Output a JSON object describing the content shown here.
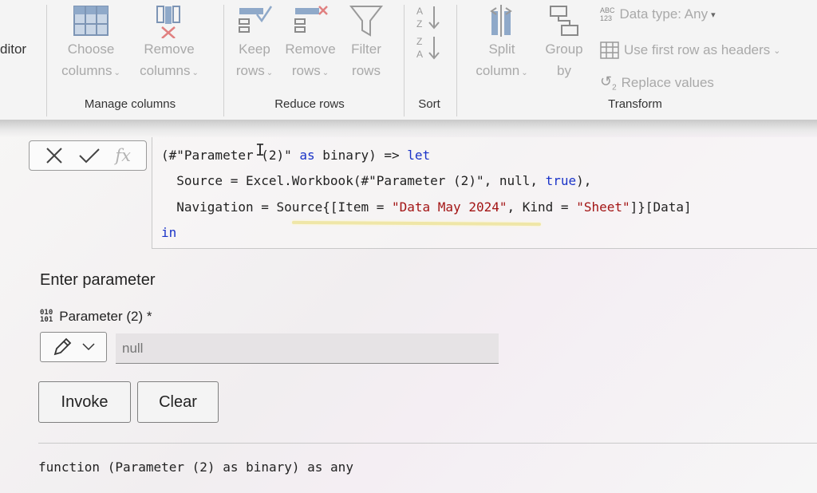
{
  "ribbon": {
    "left_title": "ditor",
    "manage_columns": {
      "label": "Manage columns",
      "choose": {
        "line1": "Choose",
        "line2": "columns"
      },
      "remove": {
        "line1": "Remove",
        "line2": "columns"
      }
    },
    "reduce_rows": {
      "label": "Reduce rows",
      "keep": {
        "line1": "Keep",
        "line2": "rows"
      },
      "remove": {
        "line1": "Remove",
        "line2": "rows"
      },
      "filter": {
        "line1": "Filter",
        "line2": "rows"
      }
    },
    "sort": {
      "label": "Sort"
    },
    "transform": {
      "label": "Transform",
      "split": {
        "line1": "Split",
        "line2": "column"
      },
      "group": {
        "line1": "Group",
        "line2": "by"
      },
      "data_type": "Data type: Any",
      "first_row_headers": "Use first row as headers",
      "replace_values": "Replace values"
    }
  },
  "formula_bar": {
    "cancel_icon": "close-icon",
    "commit_icon": "check-icon",
    "fx_label": "fx"
  },
  "code": {
    "line1": {
      "a": "(#\"Paramete",
      "b": "r (2)\" ",
      "kw1": "as",
      "c": " binary) => ",
      "kw2": "let"
    },
    "line2": {
      "a": "  Source = Excel.Workbook(#\"Parameter (2)\", null, ",
      "kw": "true",
      "b": "),"
    },
    "line3": {
      "a": "  Navigation = Source{[Item = ",
      "s1": "\"Data May 2024\"",
      "b": ", Kind = ",
      "s2": "\"Sheet\"",
      "c": "]}[Data]"
    },
    "line4": {
      "kw": "in"
    }
  },
  "invoke_panel": {
    "title": "Enter parameter",
    "param_label": "Parameter (2) *",
    "param_icon_top": "010",
    "param_icon_bottom": "101",
    "param_placeholder": "null",
    "invoke_label": "Invoke",
    "clear_label": "Clear",
    "signature": "function (Parameter (2) as binary) as any"
  },
  "colors": {
    "keyword": "#1a33c8",
    "string": "#a31515",
    "disabled_text": "#a9a9a9"
  }
}
